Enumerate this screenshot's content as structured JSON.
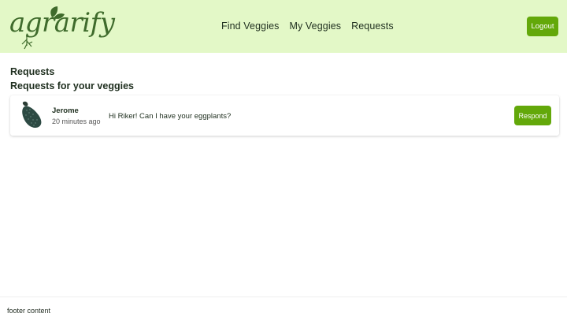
{
  "brand": {
    "logo_text": "agrarify",
    "accent": "#63a80a",
    "header_bg": "#e3f8c7"
  },
  "nav": {
    "items": [
      {
        "label": "Find Veggies"
      },
      {
        "label": "My Veggies"
      },
      {
        "label": "Requests"
      }
    ],
    "logout_label": "Logout"
  },
  "main": {
    "page_title": "Requests",
    "section_title": "Requests for your veggies",
    "requests": [
      {
        "icon": "eggplant-icon",
        "name": "Jerome",
        "time": "20 minutes ago",
        "message": "Hi Riker! Can I have your eggplants?",
        "respond_label": "Respond"
      }
    ]
  },
  "footer": {
    "text": "footer content"
  }
}
